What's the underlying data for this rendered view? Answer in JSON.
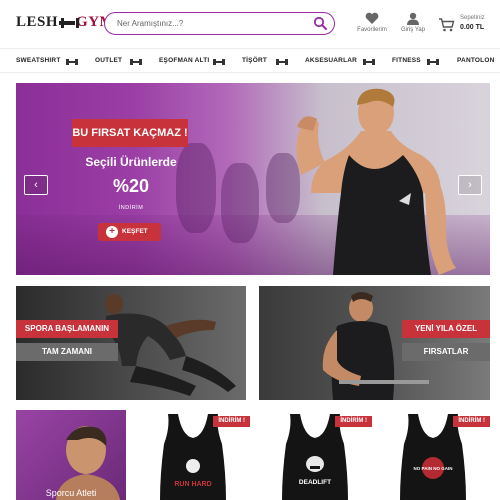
{
  "header": {
    "logo_left": "LESH",
    "logo_right": "GYM",
    "search_placeholder": "Ner Aramıştınız...?",
    "favorites_label": "Favorilerim",
    "login_label": "Giriş Yap",
    "cart_label": "Sepetiniz",
    "cart_total": "0.00 TL"
  },
  "nav": {
    "items": [
      "SWEATSHIRT",
      "OUTLET",
      "EŞOFMAN ALTI",
      "TİŞÖRT",
      "AKSESUARLAR",
      "FITNESS",
      "PANTOLON"
    ]
  },
  "hero": {
    "badge": "BU FIRSAT KAÇMAZ !",
    "subtitle": "Seçili Ürünlerde",
    "percent": "%20",
    "small": "İNDİRİM",
    "button": "KEŞFET",
    "prev": "‹",
    "next": "›"
  },
  "promos": [
    {
      "red": "SPORA BAŞLAMANIN",
      "grey": "TAM ZAMANI"
    },
    {
      "red": "YENİ YILA ÖZEL",
      "grey": "FIRSATLAR"
    }
  ],
  "products": {
    "side_title": "Sporcu Atleti",
    "badge": "İNDİRİM !",
    "prints": [
      "RUN HARD",
      "DEADLIFT",
      "NO PAIN NO GAIN"
    ]
  },
  "colors": {
    "accent_red": "#c8323b",
    "brand_purple": "#9b2aa6",
    "grey_bar": "#6b6b6b"
  }
}
